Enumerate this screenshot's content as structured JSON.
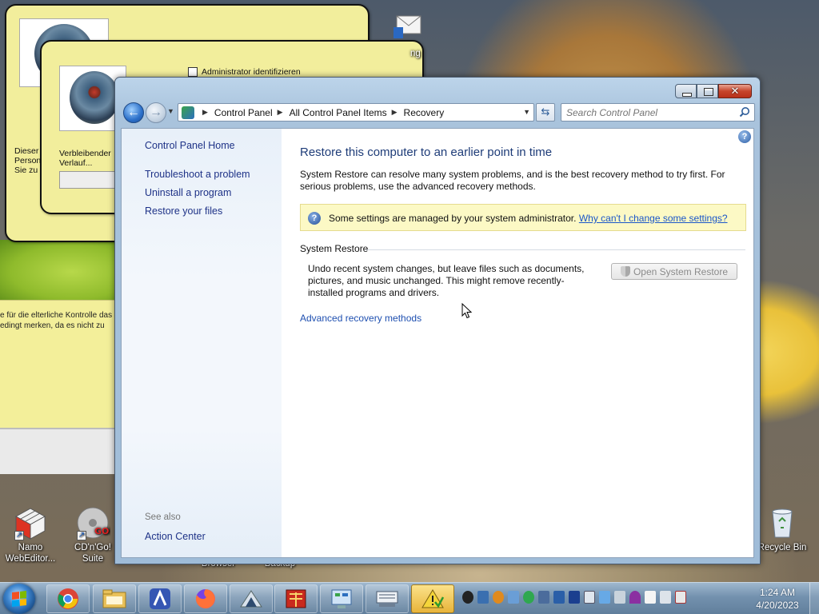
{
  "background_dialogs": {
    "checkbox_label": "Administrator identifizieren",
    "dialog2_text": [
      "Verbleibender",
      "Verlauf..."
    ],
    "dialog1_text": [
      "Dieser",
      "Person",
      "Sie zu"
    ],
    "panel_text": [
      "e für die elterliche Kontrolle das",
      "edingt merken, da es nicht zu"
    ]
  },
  "desktop_icons": [
    {
      "label_lines": [
        "Namo",
        "WebEditor..."
      ]
    },
    {
      "label_lines": [
        "CD'n'Go!",
        "Suite"
      ]
    },
    {
      "label_lines": [
        "Browser"
      ]
    },
    {
      "label_lines": [
        "Backup"
      ]
    },
    {
      "label_lines": [
        "Recycle Bin"
      ]
    },
    {
      "label_lines": [
        "ng"
      ]
    }
  ],
  "window": {
    "controls": {
      "minimize": "minimize",
      "maximize": "maximize",
      "close": "close"
    },
    "address": {
      "breadcrumbs": [
        "Control Panel",
        "All Control Panel Items",
        "Recovery"
      ]
    },
    "search": {
      "placeholder": "Search Control Panel"
    },
    "left_pane": {
      "home": "Control Panel Home",
      "links": [
        "Troubleshoot a problem",
        "Uninstall a program",
        "Restore your files"
      ],
      "see_also_heading": "See also",
      "see_also_links": [
        "Action Center"
      ]
    },
    "main": {
      "title": "Restore this computer to an earlier point in time",
      "intro": "System Restore can resolve many system problems, and is the best recovery method to try first. For serious problems, use the advanced recovery methods.",
      "info_bar": {
        "message": "Some settings are managed by your system administrator.",
        "link": "Why can't I change some settings?"
      },
      "system_restore": {
        "heading": "System Restore",
        "description": "Undo recent system changes, but leave files such as documents, pictures, and music unchanged. This might remove recently-installed programs and drivers.",
        "button": "Open System Restore"
      },
      "advanced_link": "Advanced recovery methods"
    }
  },
  "taskbar": {
    "pinned": [
      "chrome",
      "explorer",
      "app-launcher",
      "firefox",
      "installer",
      "media-app",
      "control-panel",
      "keyboard-app",
      "warning-app"
    ],
    "clock": {
      "time": "1:24 AM",
      "date": "4/20/2023"
    }
  },
  "colors": {
    "link": "#1e3287",
    "title": "#1e3c78",
    "info_bg": "#fcf9c5",
    "taskbar": "#7391ae"
  }
}
